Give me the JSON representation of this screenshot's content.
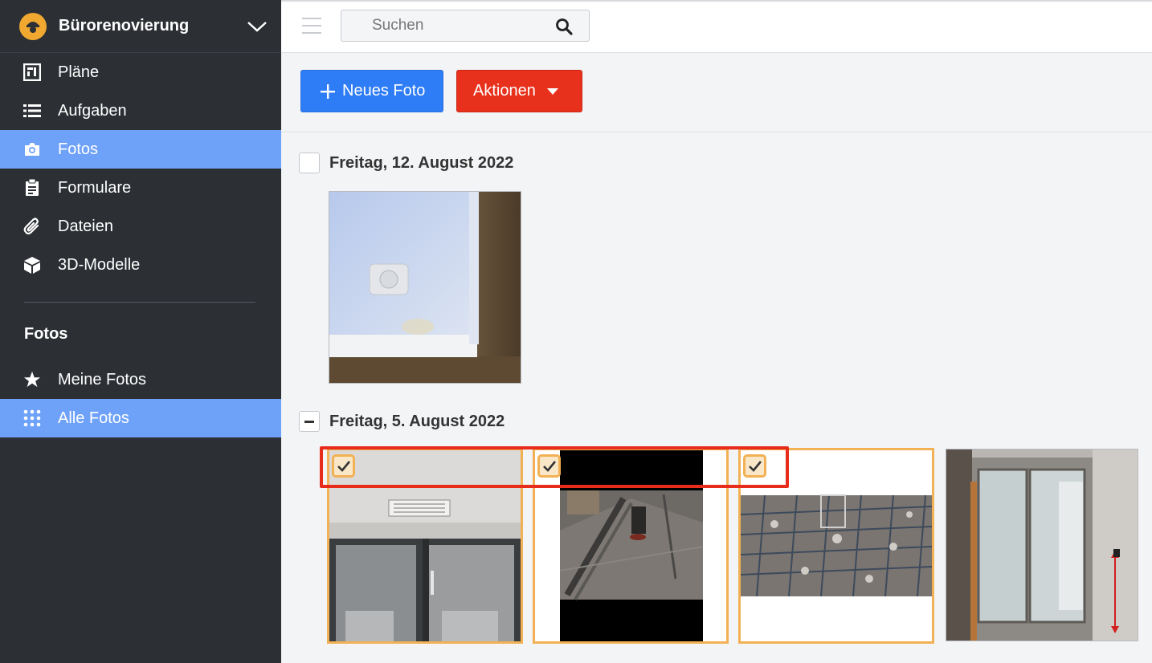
{
  "sidebar": {
    "project_name": "Bürorenovierung",
    "items": [
      {
        "label": "Pläne",
        "icon": "plans-icon"
      },
      {
        "label": "Aufgaben",
        "icon": "list-icon"
      },
      {
        "label": "Fotos",
        "icon": "camera-icon",
        "active": true
      },
      {
        "label": "Formulare",
        "icon": "clipboard-icon"
      },
      {
        "label": "Dateien",
        "icon": "paperclip-icon"
      },
      {
        "label": "3D-Modelle",
        "icon": "cube-icon"
      }
    ],
    "section_title": "Fotos",
    "sub_items": [
      {
        "label": "Meine Fotos",
        "icon": "star-icon"
      },
      {
        "label": "Alle Fotos",
        "icon": "grid-icon",
        "active": true
      }
    ]
  },
  "topbar": {
    "search_placeholder": "Suchen"
  },
  "toolbar": {
    "new_photo_label": "Neues Foto",
    "actions_label": "Aktionen"
  },
  "groups": [
    {
      "date": "Freitag, 12. August 2022",
      "checkbox_state": "unchecked",
      "photos": 1
    },
    {
      "date": "Freitag, 5. August 2022",
      "checkbox_state": "indeterminate",
      "photos": 4,
      "selected": [
        true,
        true,
        true,
        false
      ]
    }
  ],
  "colors": {
    "sidebar_bg": "#2c3035",
    "active_bg": "#6ea1f8",
    "primary_button": "#2e7cf6",
    "danger_button": "#e8311c",
    "selection": "#f2b154",
    "highlight_box": "#e82c1c"
  }
}
